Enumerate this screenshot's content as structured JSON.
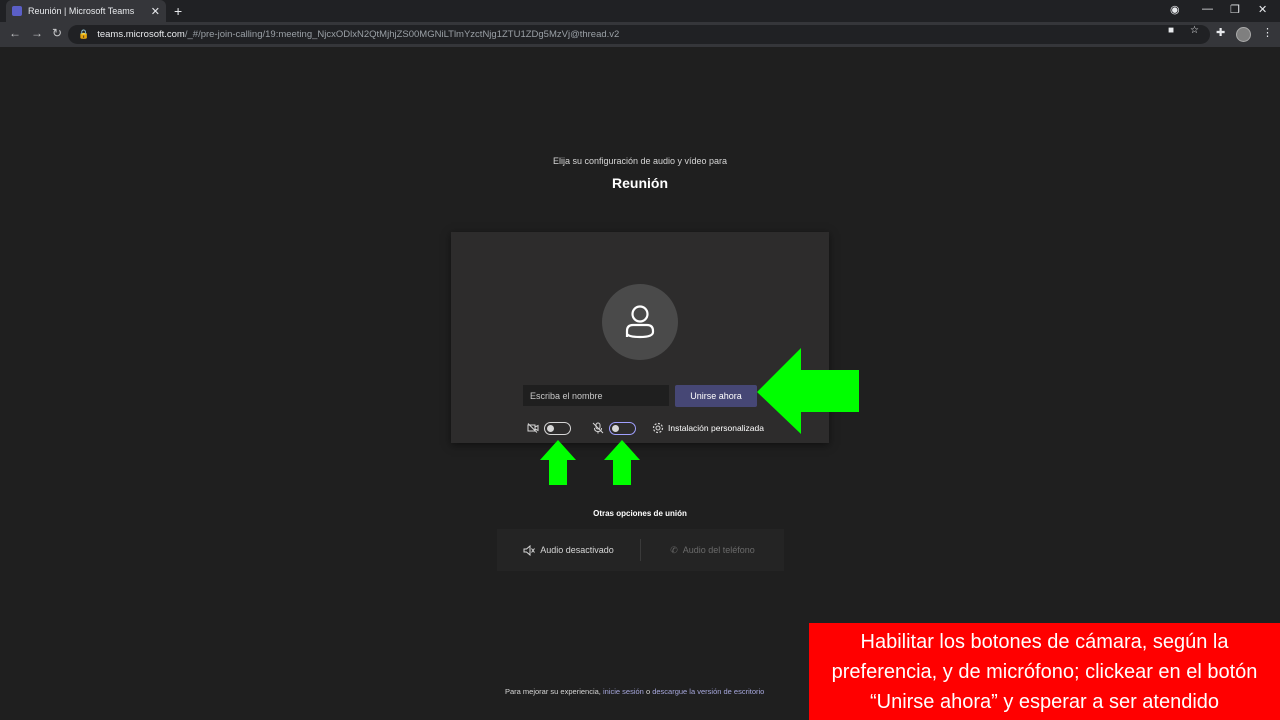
{
  "browser": {
    "tab_title": "Reunión | Microsoft Teams",
    "tab_close": "✕",
    "new_tab": "+",
    "url_host": "teams.microsoft.com",
    "url_path": "/_#/pre-join-calling/19:meeting_NjcxODlxN2QtMjhjZS00MGNiLTlmYzctNjg1ZTU1ZDg5MzVj@thread.v2"
  },
  "prejoin": {
    "subtitle": "Elija su configuración de audio y vídeo para",
    "meeting_title": "Reunión",
    "name_placeholder": "Escriba el nombre",
    "join_label": "Unirse ahora",
    "camera_on": false,
    "mic_on": false,
    "settings_label": "Instalación personalizada",
    "other_options_title": "Otras opciones de unión",
    "audio_off_label": "Audio desactivado",
    "phone_audio_label": "Audio del teléfono",
    "footer_prefix": "Para mejorar su experiencia,",
    "footer_link1": "inicie sesión",
    "footer_middle": "o",
    "footer_link2": "descargue la versión de escritorio"
  },
  "annotation": {
    "text": "Habilitar los botones de cámara, según la preferencia, y de micrófono; clickear en el botón “Unirse ahora” y esperar a ser atendido",
    "background": "#ff0000",
    "arrow_color": "#00ff00"
  },
  "colors": {
    "teams_accent": "#464775",
    "page_bg": "#1f1f1f"
  }
}
